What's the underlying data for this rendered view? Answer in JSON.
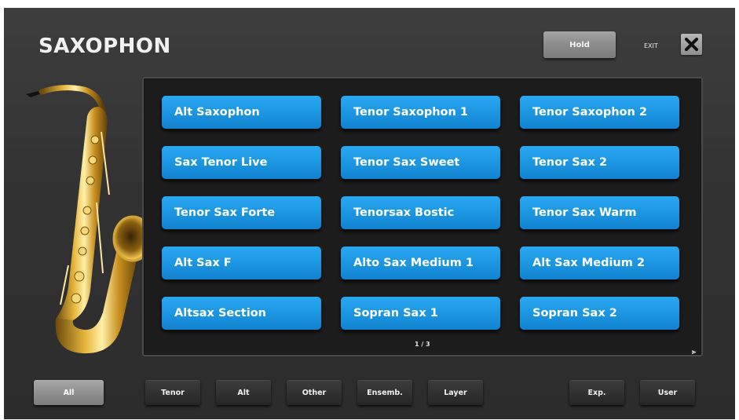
{
  "header": {
    "title": "SAXOPHON",
    "hold_label": "Hold",
    "exit_label": "EXIT",
    "close_icon": "close-x-icon"
  },
  "voices": [
    "Alt Saxophon",
    "Tenor Saxophon 1",
    "Tenor Saxophon 2",
    "Sax Tenor Live",
    "Tenor Sax Sweet",
    "Tenor Sax 2",
    "Tenor Sax Forte",
    "Tenorsax Bostic",
    "Tenor Sax Warm",
    "Alt Sax F",
    "Alto Sax Medium 1",
    "Alt Sax Medium 2",
    "Altsax Section",
    "Sopran Sax 1",
    "Sopran Sax 2"
  ],
  "pager": {
    "label": "1 / 3",
    "next_glyph": "⪢",
    "next_icon": "next-page-icon"
  },
  "categories": {
    "all": "All",
    "tenor": "Tenor",
    "alt": "Alt",
    "other": "Other",
    "ensemble": "Ensemb.",
    "layer": "Layer",
    "exp": "Exp.",
    "user": "User"
  },
  "colors": {
    "voice_button": "#1c96e2",
    "active_category": "#8e8e8e",
    "background": "#333333"
  }
}
